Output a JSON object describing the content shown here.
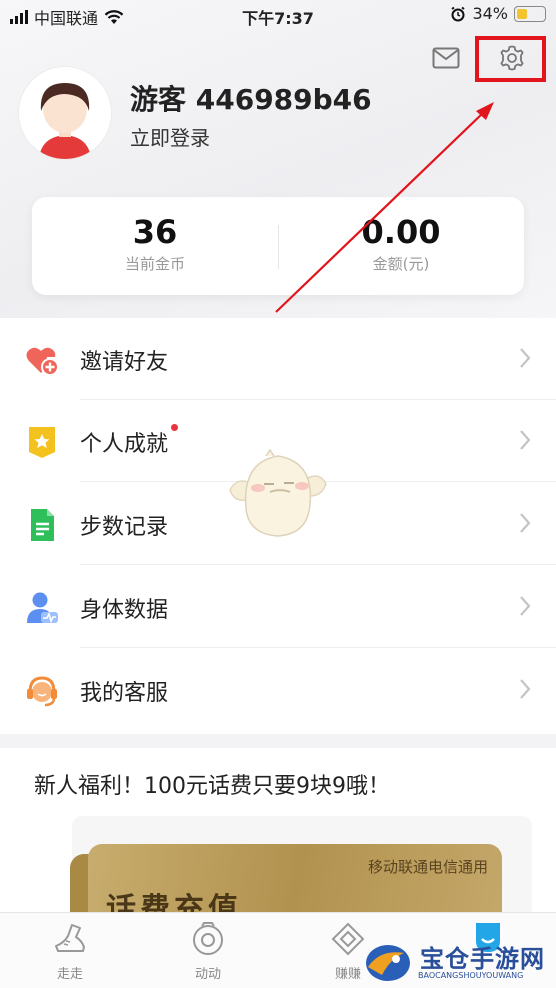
{
  "status_bar": {
    "carrier": "中国联通",
    "time": "下午7:37",
    "battery": "34%"
  },
  "header": {
    "username": "游客 446989b46",
    "login_link": "立即登录"
  },
  "stats": {
    "coins_value": "36",
    "coins_label": "当前金币",
    "amount_value": "0.00",
    "amount_label": "金额(元)"
  },
  "menu": {
    "items": [
      {
        "label": "邀请好友",
        "icon": "heart-plus-icon"
      },
      {
        "label": "个人成就",
        "icon": "star-badge-icon"
      },
      {
        "label": "步数记录",
        "icon": "document-icon"
      },
      {
        "label": "身体数据",
        "icon": "person-heartbeat-icon"
      },
      {
        "label": "我的客服",
        "icon": "headset-icon"
      }
    ]
  },
  "promo": {
    "title": "新人福利！100元话费只要9块9哦！",
    "card_subtitle": "移动联通电信通用",
    "card_title": "话费充值"
  },
  "tabbar": {
    "tabs": [
      {
        "label": "走走",
        "icon": "shoe-icon"
      },
      {
        "label": "动动",
        "icon": "camera-circle-icon"
      },
      {
        "label": "赚赚",
        "icon": "diamond-coin-icon"
      }
    ]
  },
  "watermark": {
    "text": "宝仓手游网",
    "subtext": "BAOCANGSHOUYOUWANG"
  },
  "colors": {
    "highlight_red": "#e2141c",
    "invite_icon": "#f0645a",
    "achievement_icon": "#f4c21e",
    "steps_icon": "#2fbf5a",
    "body_icon": "#5b8ff0",
    "service_icon": "#f28c38"
  }
}
